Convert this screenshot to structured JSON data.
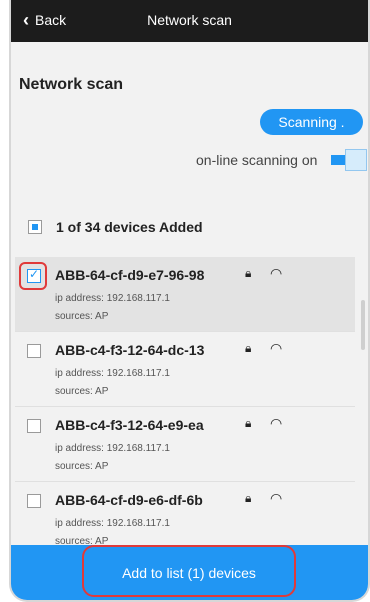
{
  "topbar": {
    "back_label": "Back",
    "title": "Network scan"
  },
  "page": {
    "title": "Network scan"
  },
  "scan": {
    "button_label": "Scanning .",
    "online_label": "on-line scanning on"
  },
  "summary": {
    "added_label": "1 of 34 devices Added"
  },
  "devices": [
    {
      "name": "ABB-64-cf-d9-e7-96-98",
      "ip": "ip address: 192.168.117.1",
      "sources": "sources: AP",
      "checked": true,
      "wifi": "strong"
    },
    {
      "name": "ABB-c4-f3-12-64-dc-13",
      "ip": "ip address: 192.168.117.1",
      "sources": "sources: AP",
      "checked": false,
      "wifi": "weak"
    },
    {
      "name": "ABB-c4-f3-12-64-e9-ea",
      "ip": "ip address: 192.168.117.1",
      "sources": "sources: AP",
      "checked": false,
      "wifi": "weak"
    },
    {
      "name": "ABB-64-cf-d9-e6-df-6b",
      "ip": "ip address: 192.168.117.1",
      "sources": "sources: AP",
      "checked": false,
      "wifi": "strong"
    }
  ],
  "bottom": {
    "add_label": "Add to list (1) devices"
  },
  "colors": {
    "accent": "#2196f3",
    "topbar": "#1c1c1c",
    "highlight": "#e03a3a"
  }
}
